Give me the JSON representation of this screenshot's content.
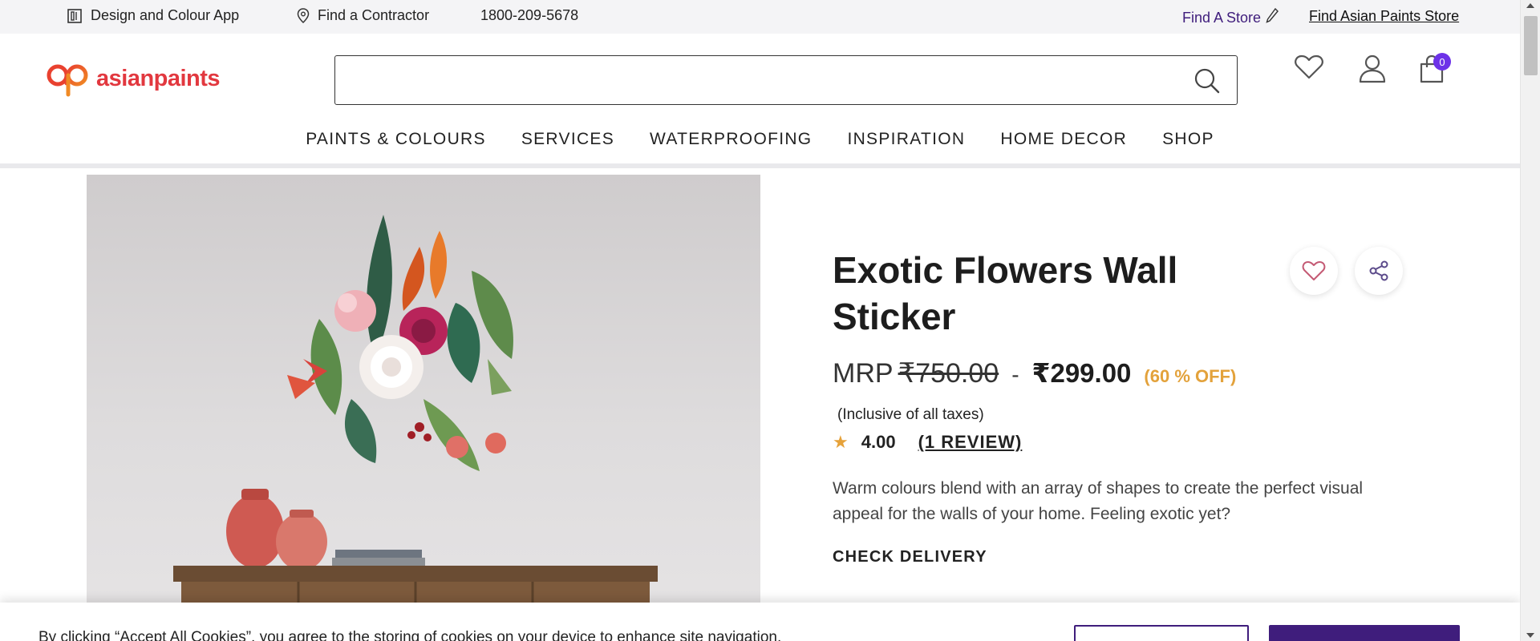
{
  "util_bar": {
    "design_app": "Design and Colour App",
    "find_contractor": "Find a Contractor",
    "phone": "1800-209-5678",
    "find_a_store": "Find A Store",
    "find_asian_paints_store": "Find Asian Paints Store"
  },
  "header": {
    "logo_text": "asianpaints",
    "search_placeholder": "",
    "cart_count": "0"
  },
  "nav": {
    "items": [
      "PAINTS & COLOURS",
      "SERVICES",
      "WATERPROOFING",
      "INSPIRATION",
      "HOME DECOR",
      "SHOP"
    ]
  },
  "product": {
    "title": "Exotic Flowers Wall Sticker",
    "mrp_label": "MRP",
    "mrp_value": "₹750.00",
    "separator": "-",
    "sale_price": "₹299.00",
    "discount": "(60 % OFF)",
    "tax_note": "(Inclusive of all taxes)",
    "rating": "4.00",
    "reviews": "(1 REVIEW)",
    "description": "Warm colours blend with an array of shapes to create the perfect visual appeal for the walls of your home. Feeling exotic yet?",
    "check_delivery": "CHECK DELIVERY"
  },
  "cookie": {
    "text": "By clicking “Accept All Cookies”, you agree to the storing of cookies on your device to enhance site navigation,"
  },
  "colors": {
    "brand_purple": "#3f1d7c",
    "accent_purple": "#6d32e8",
    "logo_red": "#e2383f",
    "discount_orange": "#e3a23b"
  },
  "icons": [
    "building-icon",
    "location-pin-icon",
    "pencil-icon",
    "search-icon",
    "heart-icon",
    "user-icon",
    "cart-icon",
    "share-icon",
    "star-icon"
  ]
}
